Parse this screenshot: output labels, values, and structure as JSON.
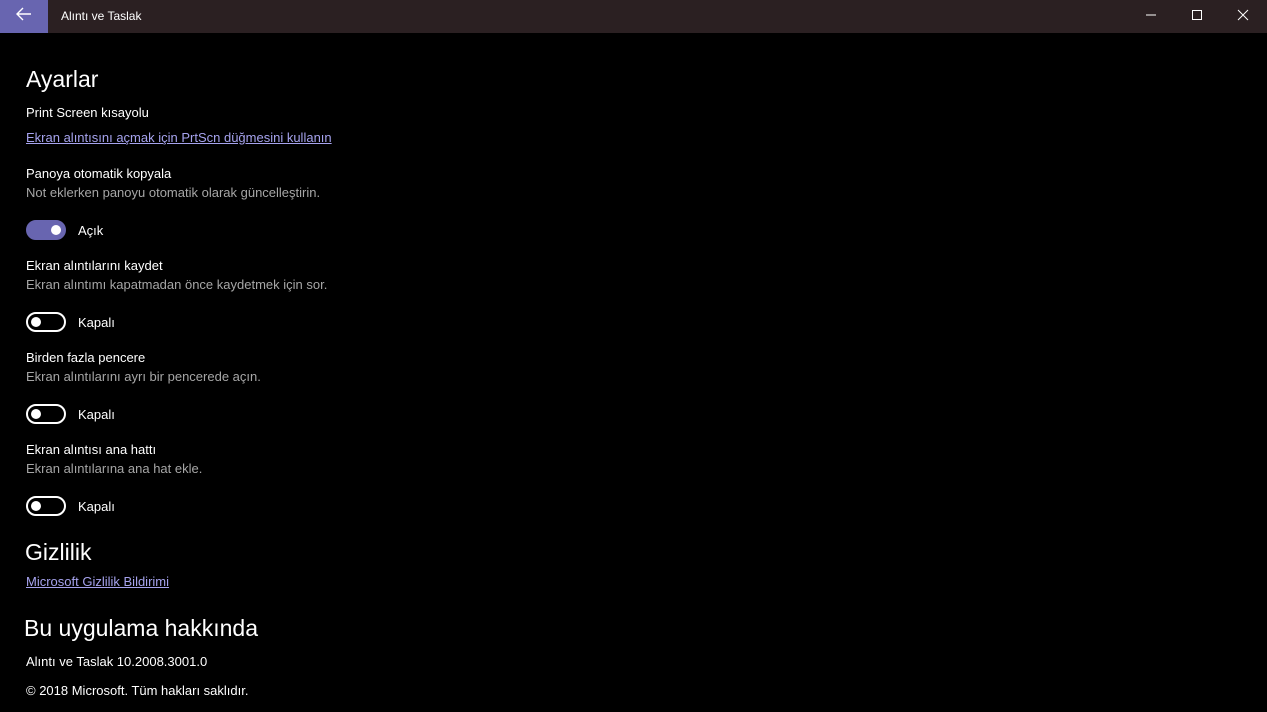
{
  "window": {
    "title": "Alıntı ve Taslak",
    "back_icon": "arrow-left-icon",
    "minimize_icon": "minimize-icon",
    "maximize_icon": "maximize-icon",
    "close_icon": "close-icon",
    "accent_color": "#6865b0"
  },
  "settings": {
    "heading": "Ayarlar",
    "print_screen": {
      "title": "Print Screen kısayolu",
      "link": "Ekran alıntısını açmak için PrtScn düğmesini kullanın"
    },
    "auto_copy": {
      "title": "Panoya otomatik kopyala",
      "description": "Not eklerken panoyu otomatik olarak güncelleştirin.",
      "state": "Açık",
      "on": true
    },
    "save_snips": {
      "title": "Ekran alıntılarını kaydet",
      "description": "Ekran alıntımı kapatmadan önce kaydetmek için sor.",
      "state": "Kapalı",
      "on": false
    },
    "multiple_windows": {
      "title": "Birden fazla pencere",
      "description": "Ekran alıntılarını ayrı bir pencerede açın.",
      "state": "Kapalı",
      "on": false
    },
    "snip_outline": {
      "title": "Ekran alıntısı ana hattı",
      "description": "Ekran alıntılarına ana hat ekle.",
      "state": "Kapalı",
      "on": false
    }
  },
  "privacy": {
    "heading": "Gizlilik",
    "link": "Microsoft Gizlilik Bildirimi"
  },
  "about": {
    "heading": "Bu uygulama hakkında",
    "version": "Alıntı ve Taslak 10.2008.3001.0",
    "copyright": "© 2018 Microsoft. Tüm hakları saklıdır."
  }
}
